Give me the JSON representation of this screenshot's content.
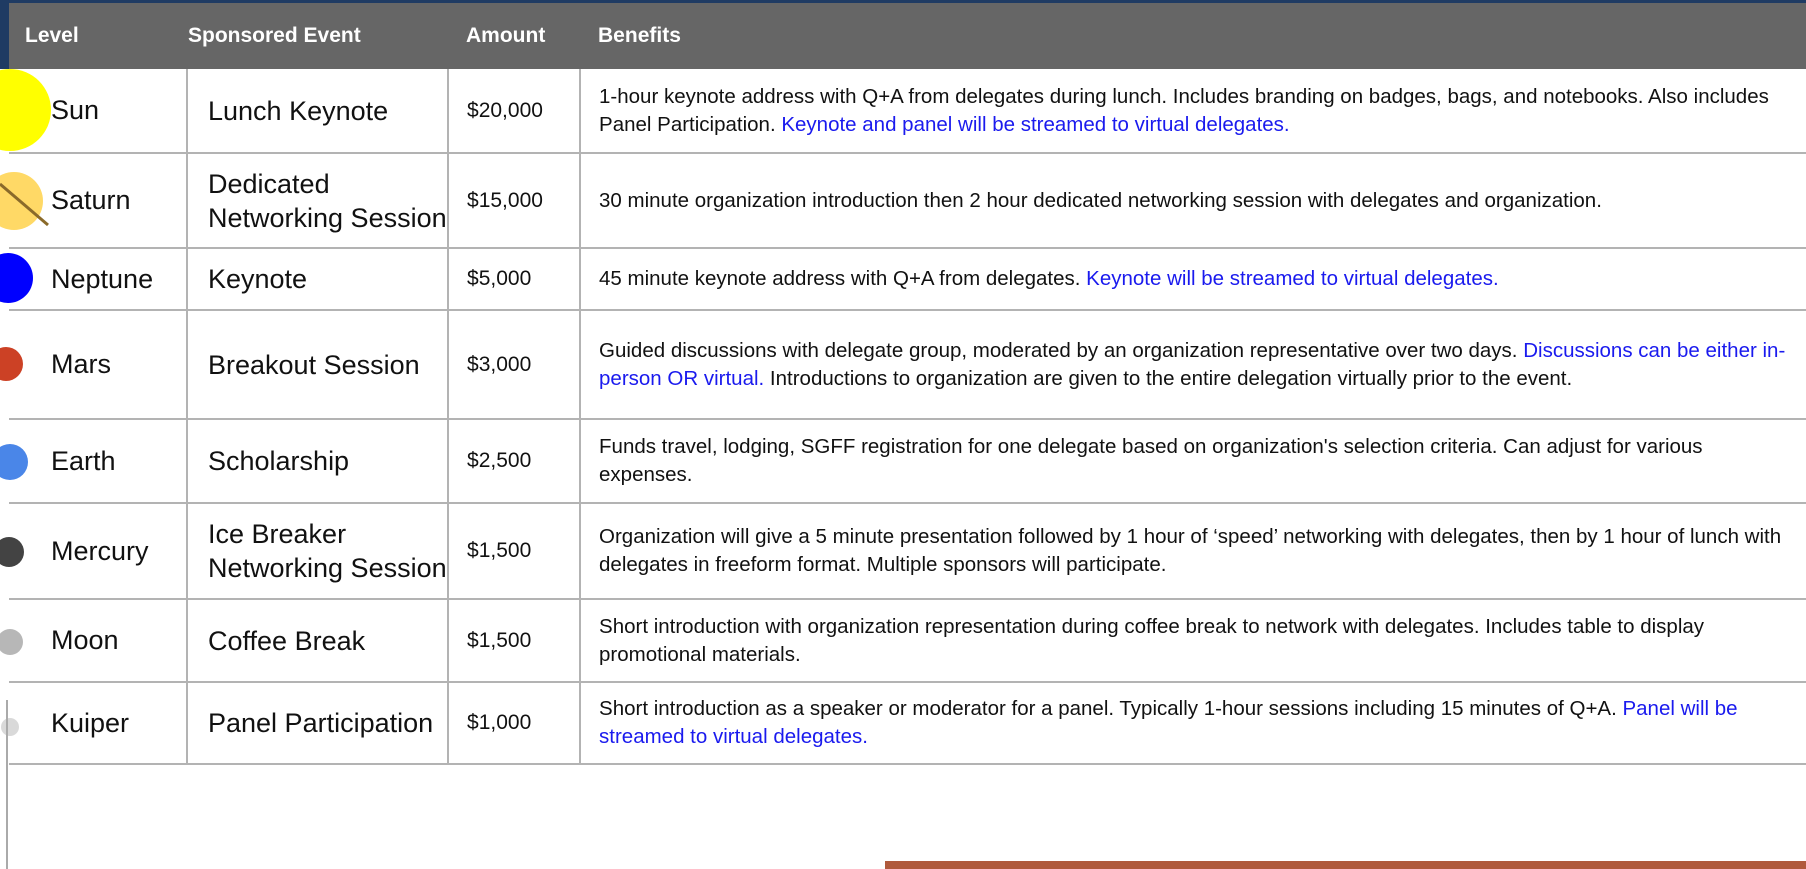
{
  "table": {
    "headers": {
      "level": "Level",
      "event": "Sponsored Event",
      "amount": "Amount",
      "benefits": "Benefits"
    },
    "rows": [
      {
        "level": "Sun",
        "event": "Lunch Keynote",
        "amount": "$20,000",
        "benefits": "1-hour keynote address with Q+A from delegates during lunch. Includes branding on badges, bags, and notebooks. Also includes Panel Participation.",
        "benefits_highlight": "Keynote and panel will be streamed to virtual delegates.",
        "benefits_tail": "",
        "planet_color": "#ffff00"
      },
      {
        "level": "Saturn",
        "event": "Dedicated Networking Session",
        "amount": "$15,000",
        "benefits": "30 minute organization introduction then 2 hour dedicated networking session with delegates and organization.",
        "benefits_highlight": "",
        "benefits_tail": "",
        "planet_color": "#ffd966"
      },
      {
        "level": "Neptune",
        "event": "Keynote",
        "amount": "$5,000",
        "benefits": "45 minute keynote address with Q+A from delegates.",
        "benefits_highlight": "Keynote will be streamed to virtual delegates.",
        "benefits_tail": "",
        "planet_color": "#0000ff"
      },
      {
        "level": "Mars",
        "event": "Breakout Session",
        "amount": "$3,000",
        "benefits": "Guided discussions with delegate group, moderated by an organization representative over two days.",
        "benefits_highlight": "Discussions can be either in-person OR virtual.",
        "benefits_tail": "Introductions to organization are given to the entire delegation virtually prior to the event.",
        "planet_color": "#cc4125"
      },
      {
        "level": "Earth",
        "event": "Scholarship",
        "amount": "$2,500",
        "benefits": "Funds travel, lodging, SGFF registration for one delegate based on organization's selection criteria. Can adjust for various expenses.",
        "benefits_highlight": "",
        "benefits_tail": "",
        "planet_color": "#4a86e8"
      },
      {
        "level": "Mercury",
        "event": "Ice Breaker Networking Session",
        "amount": "$1,500",
        "benefits": "Organization will give a 5 minute presentation followed by 1 hour of ‘speed’ networking with delegates, then by 1 hour of lunch with delegates in freeform format. Multiple sponsors will participate.",
        "benefits_highlight": "",
        "benefits_tail": "",
        "planet_color": "#434343"
      },
      {
        "level": "Moon",
        "event": "Coffee Break",
        "amount": "$1,500",
        "benefits": "Short introduction with organization representation during coffee break to network with delegates. Includes table to display promotional materials.",
        "benefits_highlight": "",
        "benefits_tail": "",
        "planet_color": "#b7b7b7"
      },
      {
        "level": "Kuiper",
        "event": "Panel Participation",
        "amount": "$1,000",
        "benefits": "Short introduction as a speaker or moderator for a panel. Typically 1-hour sessions including 15 minutes of Q+A.",
        "benefits_highlight": "Panel will be streamed to virtual delegates.",
        "benefits_tail": "",
        "planet_color": "#d9d9d9"
      }
    ]
  }
}
